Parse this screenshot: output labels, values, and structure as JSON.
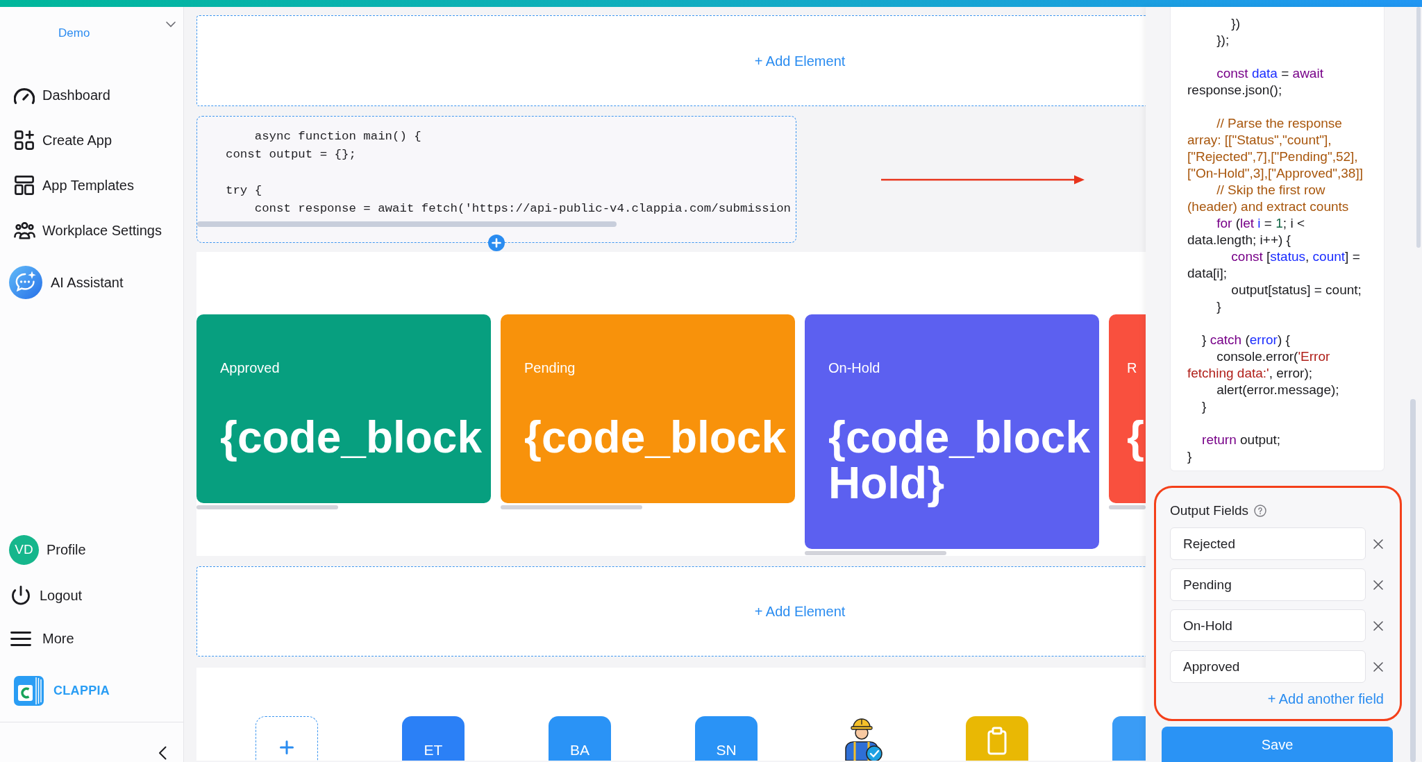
{
  "sidebar": {
    "workspace": "Demo",
    "nav_items": [
      {
        "label": "Dashboard",
        "selected": false
      },
      {
        "label": "Create App",
        "selected": false
      },
      {
        "label": "App Templates",
        "selected": false
      },
      {
        "label": "Workplace Settings",
        "selected": false
      }
    ],
    "assistant": {
      "label": "AI Assistant"
    },
    "profile": {
      "initials": "VD",
      "label": "Profile"
    },
    "menu_items": [
      {
        "label": "Logout"
      },
      {
        "label": "More"
      }
    ],
    "brand": "CLAPPIA"
  },
  "canvas": {
    "add_element_top": "+ Add Element",
    "code_block": {
      "blocks": [
        [
          "    async function main() {",
          "const output = {};"
        ],
        [
          "try {",
          "    const response = await fetch('https://api-public-v4.clappia.com/submission"
        ]
      ]
    },
    "stat_cards": [
      {
        "label": "Approved",
        "value": "{code_block",
        "color": "#079f7f"
      },
      {
        "label": "Pending",
        "value": "{code_block",
        "color": "#f8920b"
      },
      {
        "label": "On-Hold",
        "value": "{code_block Hold}",
        "color": "#5c60f0"
      },
      {
        "label": "R",
        "value": "{",
        "color": "#f9503e"
      }
    ],
    "add_element_bottom": "+ Add Element",
    "apps": [
      {
        "kind": "add"
      },
      {
        "kind": "initials",
        "text": "ET",
        "color": "#2b80f6"
      },
      {
        "kind": "initials",
        "text": "BA",
        "color": "#2a93f6"
      },
      {
        "kind": "initials",
        "text": "SN",
        "color": "#2a93f6"
      },
      {
        "kind": "illustration"
      },
      {
        "kind": "clipboard",
        "color": "#e9b804"
      },
      {
        "kind": "tile",
        "color": "#3a9cf6"
      }
    ]
  },
  "code_panel": {
    "blocks": [
      [
        [
          {
            "text": "            })",
            "kind": "plain"
          }
        ],
        [
          {
            "text": "        });",
            "kind": "plain"
          }
        ]
      ],
      [
        [
          {
            "text": "        const",
            "kind": "keyword"
          },
          {
            "text": " data",
            "kind": "def"
          },
          {
            "text": " = ",
            "kind": "plain"
          },
          {
            "text": "await",
            "kind": "keyword"
          }
        ],
        [
          {
            "text": "response.json();",
            "kind": "plain"
          }
        ]
      ],
      [
        [
          {
            "text": "        // Parse the response",
            "kind": "comment"
          }
        ],
        [
          {
            "text": "array: [[\"Status\",\"count\"],",
            "kind": "comment"
          }
        ],
        [
          {
            "text": "[\"Rejected\",7],[\"Pending\",52],",
            "kind": "comment"
          }
        ],
        [
          {
            "text": "[\"On-Hold\",3],[\"Approved\",38]]",
            "kind": "comment"
          }
        ],
        [
          {
            "text": "        // Skip the first row",
            "kind": "comment"
          }
        ],
        [
          {
            "text": "(header) and extract counts",
            "kind": "comment"
          }
        ],
        [
          {
            "text": "        for",
            "kind": "keyword"
          },
          {
            "text": " (",
            "kind": "plain"
          },
          {
            "text": "let",
            "kind": "keyword"
          },
          {
            "text": " i",
            "kind": "def"
          },
          {
            "text": " = ",
            "kind": "plain"
          },
          {
            "text": "1",
            "kind": "number"
          },
          {
            "text": "; i <",
            "kind": "plain"
          }
        ],
        [
          {
            "text": "data.length; i++) {",
            "kind": "plain"
          }
        ],
        [
          {
            "text": "            const",
            "kind": "keyword"
          },
          {
            "text": " [",
            "kind": "plain"
          },
          {
            "text": "status",
            "kind": "def"
          },
          {
            "text": ", ",
            "kind": "plain"
          },
          {
            "text": "count",
            "kind": "def"
          },
          {
            "text": "] =",
            "kind": "plain"
          }
        ],
        [
          {
            "text": "data[i];",
            "kind": "plain"
          }
        ],
        [
          {
            "text": "            output[status] = count;",
            "kind": "plain"
          }
        ],
        [
          {
            "text": "        }",
            "kind": "plain"
          }
        ]
      ],
      [
        [
          {
            "text": "    } ",
            "kind": "plain"
          },
          {
            "text": "catch",
            "kind": "keyword"
          },
          {
            "text": " (",
            "kind": "plain"
          },
          {
            "text": "error",
            "kind": "def"
          },
          {
            "text": ") {",
            "kind": "plain"
          }
        ],
        [
          {
            "text": "        console.error(",
            "kind": "plain"
          },
          {
            "text": "'Error",
            "kind": "string"
          }
        ],
        [
          {
            "text": "fetching data:'",
            "kind": "string"
          },
          {
            "text": ", error);",
            "kind": "plain"
          }
        ],
        [
          {
            "text": "        alert(error.message);",
            "kind": "plain"
          }
        ],
        [
          {
            "text": "    }",
            "kind": "plain"
          }
        ]
      ],
      [
        [
          {
            "text": "    return",
            "kind": "keyword"
          },
          {
            "text": " output;",
            "kind": "plain"
          }
        ],
        [
          {
            "text": "}",
            "kind": "plain"
          }
        ]
      ]
    ]
  },
  "output_fields": {
    "title": "Output Fields",
    "fields": [
      {
        "value": "Rejected"
      },
      {
        "value": "Pending"
      },
      {
        "value": "On-Hold"
      },
      {
        "value": "Approved"
      }
    ],
    "add_link": "+ Add another field"
  },
  "save_button": "Save"
}
